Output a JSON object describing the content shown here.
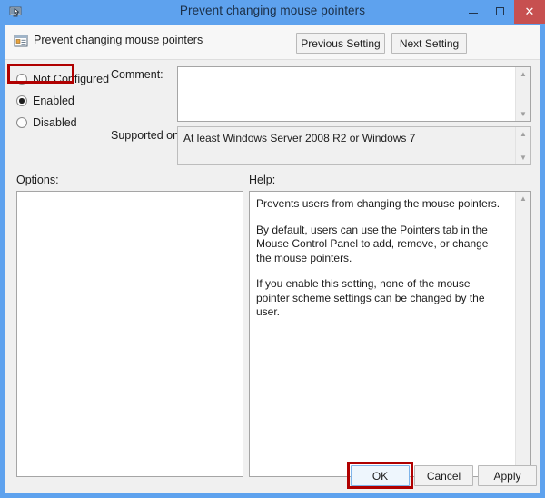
{
  "window": {
    "title": "Prevent changing mouse pointers",
    "title_icon": "mouse-policy-icon",
    "controls": {
      "minimize": "–",
      "maximize": "☐",
      "close": "✕"
    }
  },
  "header": {
    "icon": "policy-setting-icon",
    "setting_name": "Prevent changing mouse pointers",
    "previous_button": "Previous Setting",
    "next_button": "Next Setting"
  },
  "state": {
    "options": [
      {
        "label": "Not Configured",
        "selected": false
      },
      {
        "label": "Enabled",
        "selected": true
      },
      {
        "label": "Disabled",
        "selected": false
      }
    ],
    "selected": "Enabled"
  },
  "comment": {
    "label": "Comment:",
    "value": "",
    "scroll_up_icon": "chevron-up-icon",
    "scroll_down_icon": "chevron-down-icon"
  },
  "supported_on": {
    "label": "Supported on:",
    "value": "At least Windows Server 2008 R2 or Windows 7",
    "scroll_up_icon": "chevron-up-icon",
    "scroll_down_icon": "chevron-down-icon"
  },
  "options_panel": {
    "label": "Options:",
    "content": ""
  },
  "help_panel": {
    "label": "Help:",
    "paragraphs": [
      "Prevents users from changing the mouse pointers.",
      "By default, users can use the Pointers tab in the Mouse Control Panel to add, remove, or change the mouse pointers.",
      "If you enable this setting, none of the mouse pointer scheme settings can be changed by the user."
    ],
    "scroll_up_icon": "chevron-up-icon",
    "scroll_down_icon": "chevron-down-icon"
  },
  "footer": {
    "ok": "OK",
    "cancel": "Cancel",
    "apply": "Apply"
  },
  "annotations": {
    "color": "#b00000",
    "highlighted": [
      "Enabled",
      "OK"
    ]
  }
}
